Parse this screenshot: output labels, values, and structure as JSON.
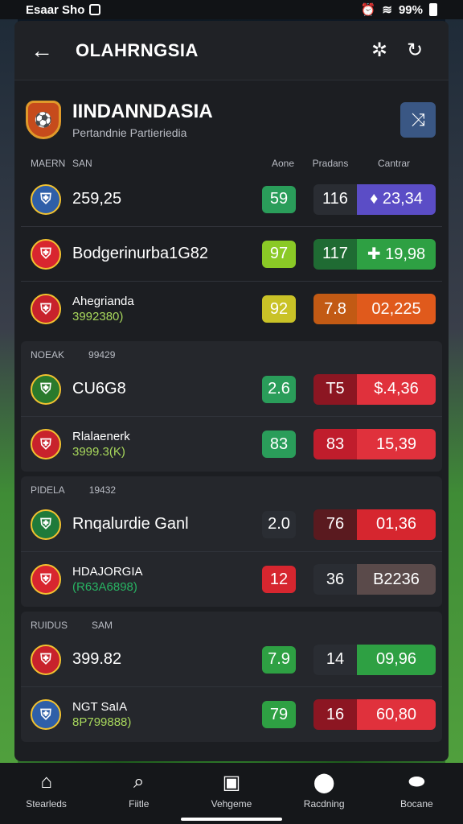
{
  "status_bar": {
    "carrier": "Esaar Sho",
    "battery": "99%"
  },
  "header": {
    "title": "OLAHRNGSIA"
  },
  "team": {
    "name": "IINDANNDASIA",
    "subtitle": "Pertandnie Partieriedia"
  },
  "columns": {
    "c1": "MAERN",
    "c2": "SAN",
    "c3": "Aone",
    "c4": "Pradans",
    "c5": "Cantrar"
  },
  "groups": [
    {
      "header": [
        "",
        ""
      ],
      "rows": [
        {
          "name": "259,25",
          "sub": "",
          "score": "59",
          "num": "116",
          "value": "♦ 23,34",
          "crest_color": "#2f5fa8",
          "badge_color": "#2a9d5a",
          "p1_color": "#2a2d33",
          "p2_color": "#5b4dc6"
        },
        {
          "name": "Bodgerinurba1G82",
          "sub": "",
          "score": "97",
          "num": "117",
          "value": "✚ 19,98",
          "crest_color": "#d8262f",
          "badge_color": "#8ac926",
          "p1_color": "#1f6b33",
          "p2_color": "#2ea043"
        },
        {
          "name": "Ahegrianda",
          "sub": "3992380)",
          "score": "92",
          "num": "7.8",
          "value": "02,225",
          "crest_color": "#c8222c",
          "badge_color": "#c9c227",
          "p1_color": "#c25a14",
          "p2_color": "#e05a1c"
        }
      ]
    },
    {
      "header": [
        "NOEAK",
        "99429"
      ],
      "rows": [
        {
          "name": "CU6G8",
          "sub": "",
          "score": "2.6",
          "num": "T5",
          "value": "$.4,36",
          "crest_color": "#2a7a2c",
          "badge_color": "#2a9d5a",
          "p1_color": "#8c1622",
          "p2_color": "#e0313c"
        },
        {
          "name": "Rlalaenerk",
          "sub": "3999.3(K)",
          "score": "83",
          "num": "83",
          "value": "15,39",
          "crest_color": "#c8222c",
          "badge_color": "#2a9d5a",
          "p1_color": "#c01d2c",
          "p2_color": "#e0313c"
        }
      ]
    },
    {
      "header": [
        "PIDELA",
        "19432"
      ],
      "rows": [
        {
          "name": "Rnqalurdie Ganl",
          "sub": "",
          "score": "2.0",
          "num": "76",
          "value": "01,36",
          "crest_color": "#1f7a3a",
          "badge_color": "#2a2d33",
          "p1_color": "#5a1a1f",
          "p2_color": "#d6262f"
        },
        {
          "name": "HDAJORGIA",
          "sub": "(R63A6898)",
          "score": "12",
          "num": "36",
          "value": "B2236",
          "crest_color": "#d8262f",
          "badge_color": "#d6262f",
          "p1_color": "#2a2d33",
          "p2_color": "#5a4a4a"
        }
      ]
    },
    {
      "header": [
        "RUIDUS",
        "SAM"
      ],
      "rows": [
        {
          "name": "399.82",
          "sub": "",
          "score": "7.9",
          "num": "14",
          "value": "09,96",
          "crest_color": "#c8222c",
          "badge_color": "#2ea043",
          "p1_color": "#2a2d33",
          "p2_color": "#2ea043"
        },
        {
          "name": "NGT SaIA",
          "sub": "8P799888)",
          "score": "79",
          "num": "16",
          "value": "60,80",
          "crest_color": "#2f5fa8",
          "badge_color": "#2ea043",
          "p1_color": "#8c1622",
          "p2_color": "#e0313c"
        }
      ]
    }
  ],
  "bottom_nav": [
    {
      "label": "Stearleds",
      "icon": "home-icon"
    },
    {
      "label": "Fiitle",
      "icon": "search-icon"
    },
    {
      "label": "Vehgeme",
      "icon": "clipboard-icon"
    },
    {
      "label": "Racdning",
      "icon": "location-icon"
    },
    {
      "label": "Bocane",
      "icon": "account-icon"
    }
  ]
}
